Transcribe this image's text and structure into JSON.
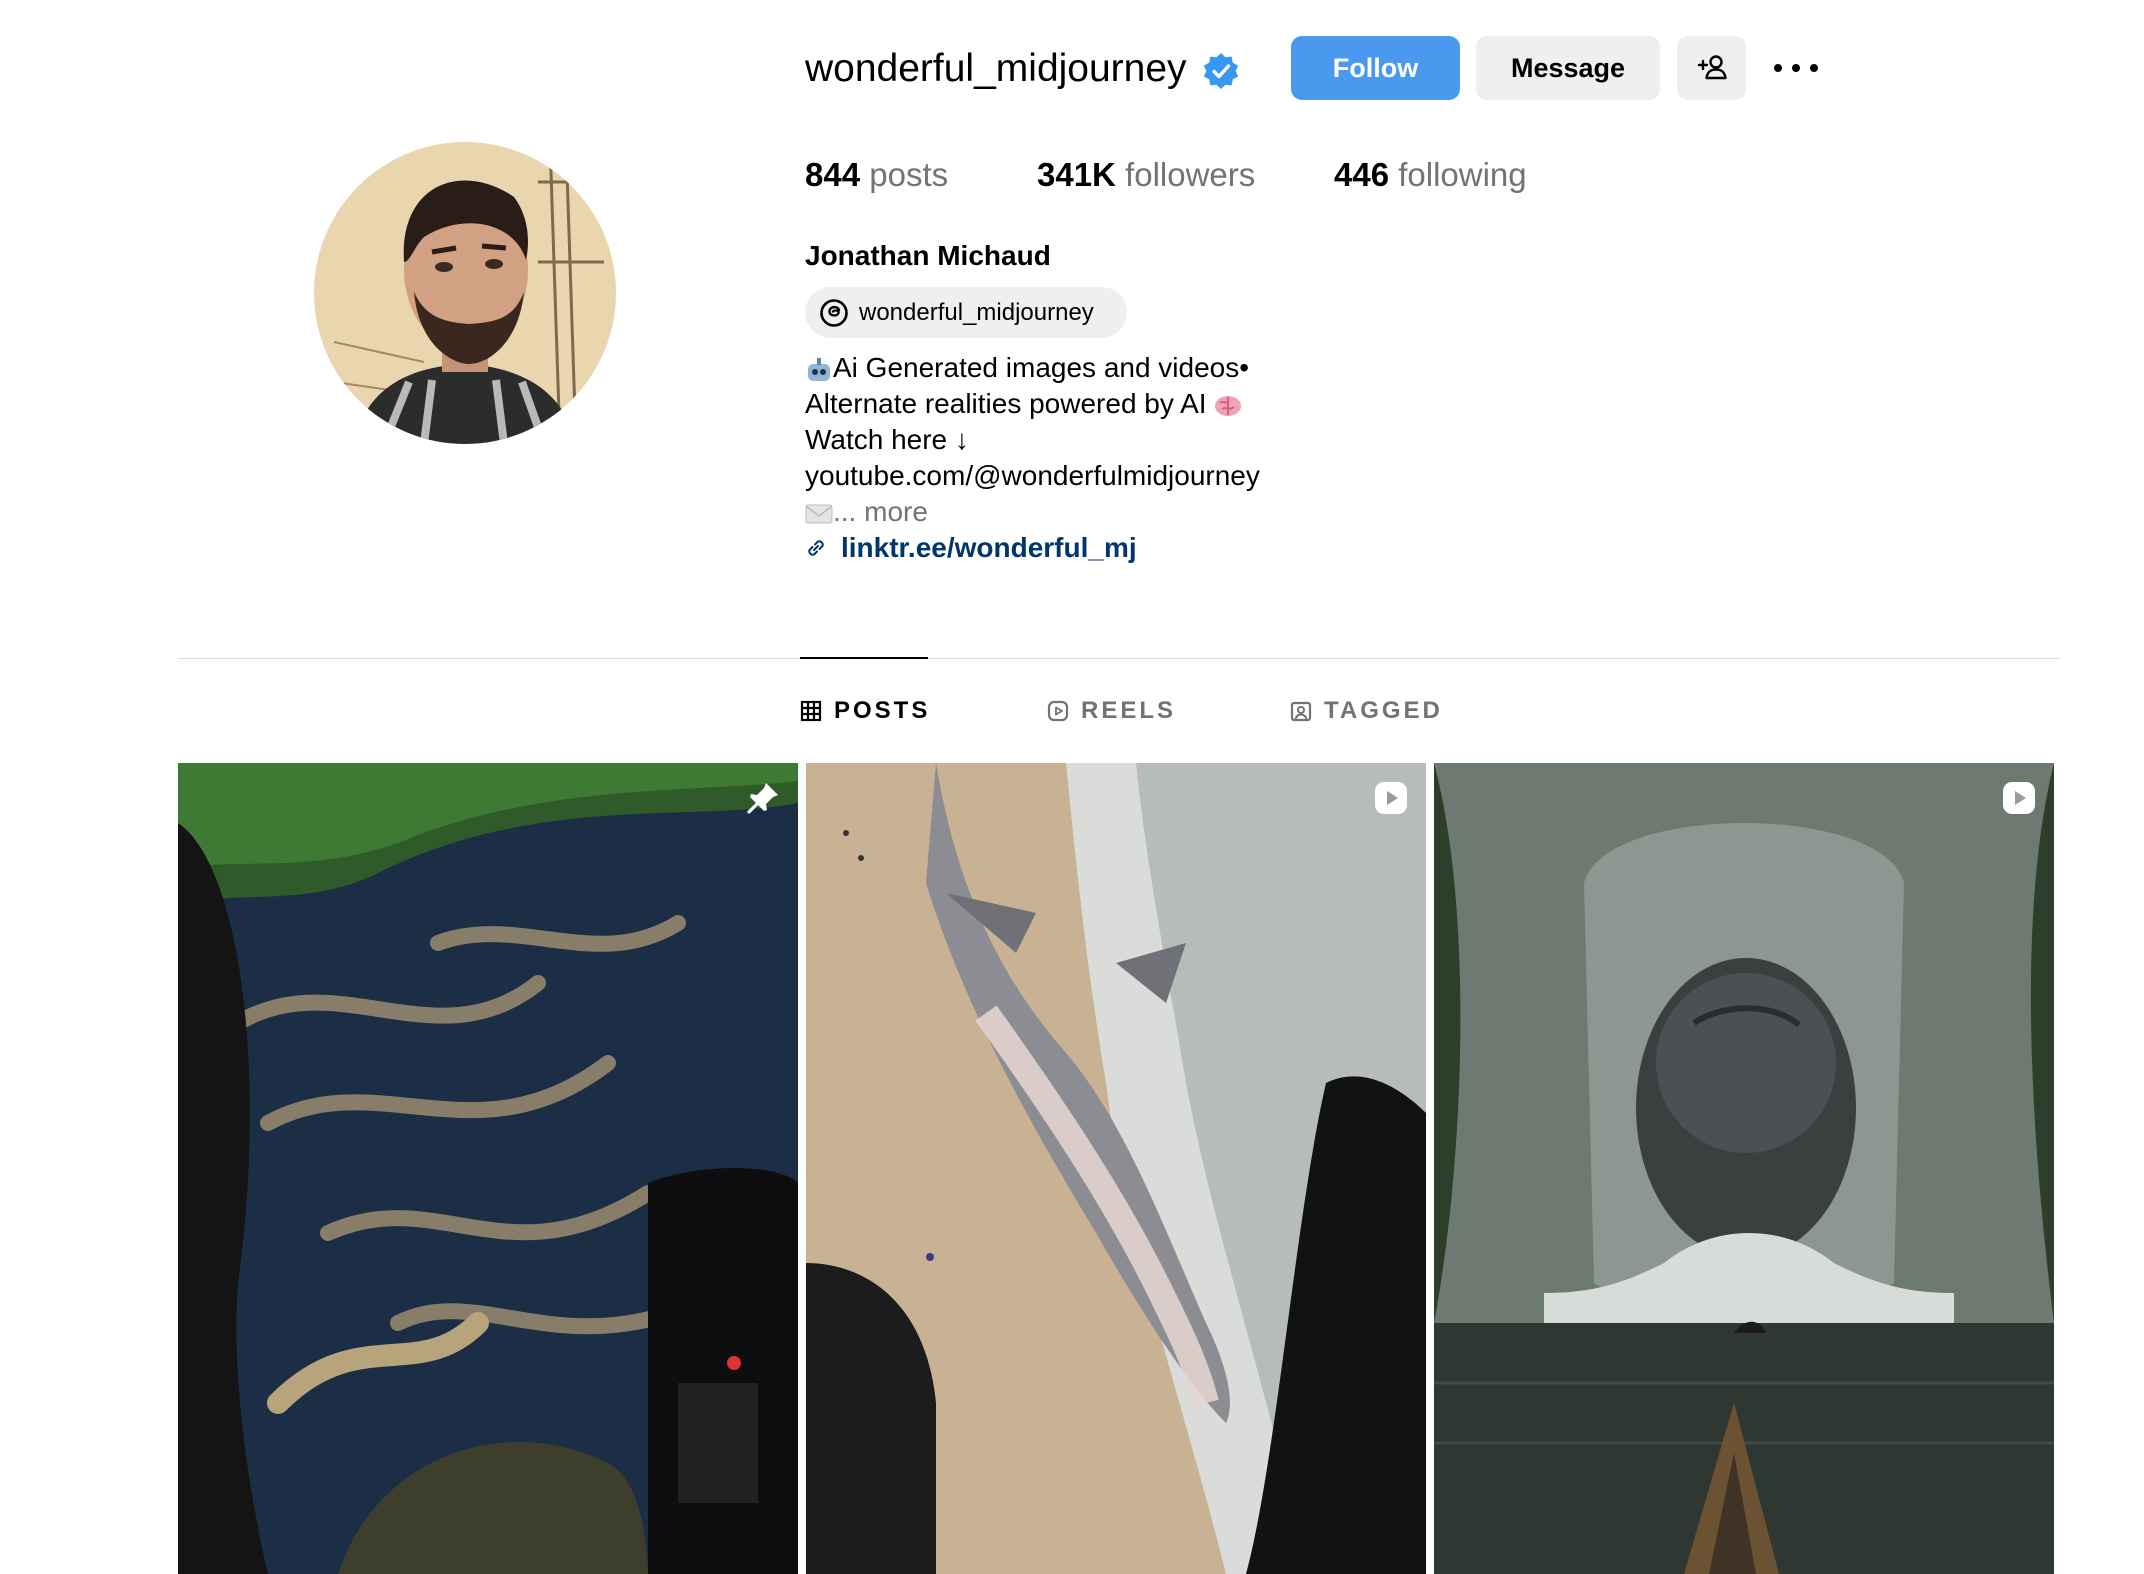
{
  "profile": {
    "username": "wonderful_midjourney",
    "verified": true,
    "follow_label": "Follow",
    "message_label": "Message",
    "stats": {
      "posts_count": "844",
      "posts_label": "posts",
      "followers_count": "341K",
      "followers_label": "followers",
      "following_count": "446",
      "following_label": "following"
    },
    "full_name": "Jonathan Michaud",
    "threads_handle": "wonderful_midjourney",
    "bio_lines": [
      "Ai Generated images and videos•",
      "Alternate realities powered by AI",
      "Watch here ↓",
      "youtube.com/@wonderfulmidjourney",
      "... more"
    ],
    "link": "linktr.ee/wonderful_mj"
  },
  "tabs": [
    {
      "label": "POSTS",
      "icon": "grid-icon",
      "active": true
    },
    {
      "label": "REELS",
      "icon": "reels-icon",
      "active": false
    },
    {
      "label": "TAGGED",
      "icon": "tagged-icon",
      "active": false
    }
  ],
  "posts": [
    {
      "badge": "pin-icon"
    },
    {
      "badge": "reel-icon"
    },
    {
      "badge": "reel-icon"
    }
  ],
  "colors": {
    "accent": "#4a99ee",
    "link": "#00376b",
    "muted": "#737373",
    "button_bg": "#efefef",
    "verified": "#3897f0"
  }
}
